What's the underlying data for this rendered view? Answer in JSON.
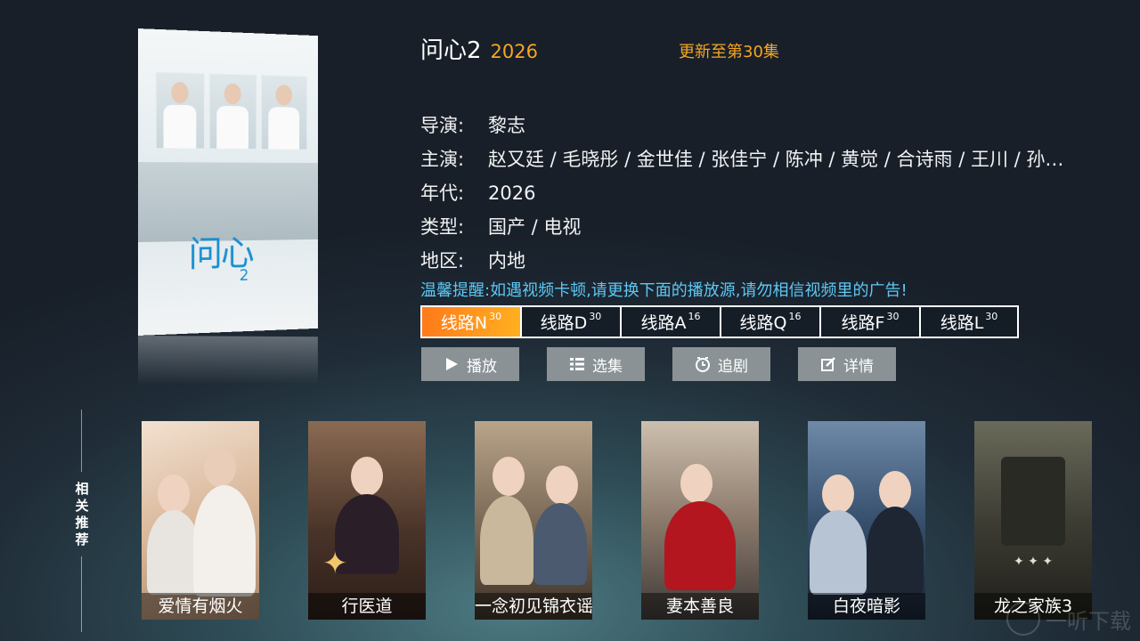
{
  "detail": {
    "title": "问心2",
    "year": "2026",
    "update_status": "更新至第30集",
    "director_label": "导演:",
    "director": "黎志",
    "cast_label": "主演:",
    "cast": "赵又廷 / 毛晓彤 / 金世佳 / 张佳宁 / 陈冲 / 黄觉 / 合诗雨 / 王川 / 孙…",
    "era_label": "年代:",
    "era": "2026",
    "genre_label": "类型:",
    "genre": "国产 / 电视",
    "region_label": "地区:",
    "region": "内地",
    "tip": "温馨提醒:如遇视频卡顿,请更换下面的播放源,请勿相信视频里的广告!"
  },
  "poster": {
    "title": "问心",
    "num": "2"
  },
  "routes": [
    {
      "name": "线路N",
      "count": "30",
      "active": true
    },
    {
      "name": "线路D",
      "count": "30",
      "active": false
    },
    {
      "name": "线路A",
      "count": "16",
      "active": false
    },
    {
      "name": "线路Q",
      "count": "16",
      "active": false
    },
    {
      "name": "线路F",
      "count": "30",
      "active": false
    },
    {
      "name": "线路L",
      "count": "30",
      "active": false
    }
  ],
  "actions": [
    {
      "label": "播放",
      "icon": "play-icon"
    },
    {
      "label": "选集",
      "icon": "list-icon"
    },
    {
      "label": "追剧",
      "icon": "clock-icon"
    },
    {
      "label": "详情",
      "icon": "edit-icon"
    }
  ],
  "related": {
    "label": "相关推荐",
    "items": [
      {
        "title": "爱情有烟火",
        "color": "#c9a27a"
      },
      {
        "title": "行医道",
        "color": "#5a4035"
      },
      {
        "title": "一念初见锦衣谣",
        "color": "#8a7a66"
      },
      {
        "title": "妻本善良",
        "color": "#6e5a4a"
      },
      {
        "title": "白夜暗影",
        "color": "#2f4a6a"
      },
      {
        "title": "龙之家族3",
        "color": "#4c4a3e"
      }
    ]
  },
  "watermark": "一听下载",
  "colors": {
    "accent": "#f5a623",
    "tip": "#5cc8f5",
    "active_route": "#ff8c1a"
  }
}
